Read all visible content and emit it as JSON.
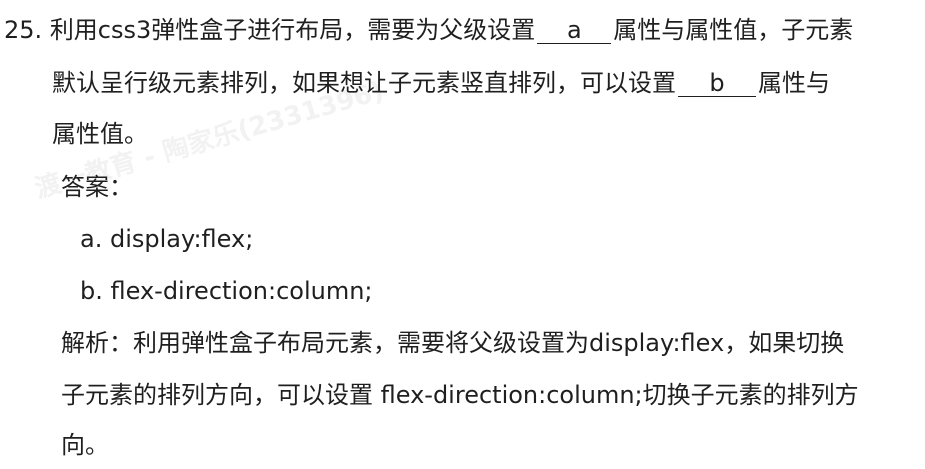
{
  "question": {
    "number": "25.",
    "line1_a": "利用css3弹性盒子进行布局，需要为父级设置",
    "blank_a": "a",
    "line1_b": "属性与属性值，子元素",
    "line2_a": "默认呈行级元素排列，如果想让子元素竖直排列，可以设置",
    "blank_b": "b",
    "line2_b": "属性与",
    "line3": "属性值。"
  },
  "answer": {
    "label": "答案：",
    "a": "a. display:flex;",
    "b": "b. flex-direction:column;"
  },
  "analysis": {
    "line1": "解析：利用弹性盒子布局元素，需要将父级设置为display:flex，如果切换",
    "line2": "子元素的排列方向，可以设置 flex-direction:column;切换子元素的排列方",
    "line3": "向。"
  },
  "watermark": "渡一教育 - 陶家乐(2331396)"
}
